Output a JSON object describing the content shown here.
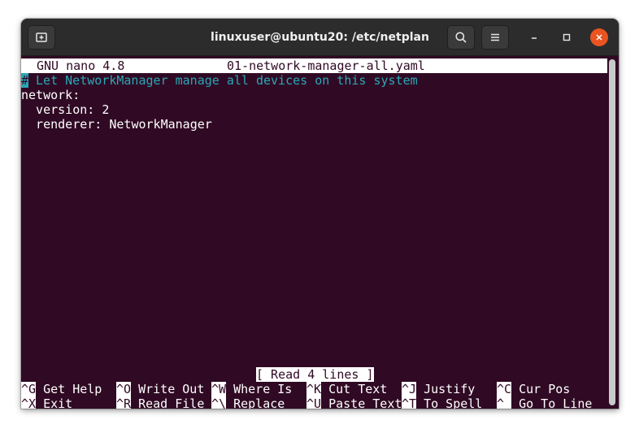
{
  "window": {
    "title": "linuxuser@ubuntu20: /etc/netplan",
    "new_tab_icon": "new-tab-icon",
    "search_icon": "search-icon",
    "menu_icon": "hamburger-menu-icon",
    "minimize_icon": "minimize-icon",
    "maximize_icon": "maximize-icon",
    "close_icon": "close-icon",
    "accent_color": "#e95420",
    "terminal_bg": "#300a24"
  },
  "nano": {
    "version": "GNU nano 4.8",
    "filename": "01-network-manager-all.yaml",
    "lines": [
      {
        "cursor": "#",
        "text": " Let NetworkManager manage all devices on this system",
        "type": "comment"
      },
      {
        "text": "network:",
        "type": "code"
      },
      {
        "text": "  version: 2",
        "type": "code"
      },
      {
        "text": "  renderer: NetworkManager",
        "type": "code"
      }
    ],
    "status": "[ Read 4 lines ]",
    "shortcuts_row1": [
      {
        "key": "^G",
        "label": " Get Help"
      },
      {
        "key": "^O",
        "label": " Write Out"
      },
      {
        "key": "^W",
        "label": " Where Is"
      },
      {
        "key": "^K",
        "label": " Cut Text"
      },
      {
        "key": "^J",
        "label": " Justify"
      },
      {
        "key": "^C",
        "label": " Cur Pos"
      }
    ],
    "shortcuts_row2": [
      {
        "key": "^X",
        "label": " Exit"
      },
      {
        "key": "^R",
        "label": " Read File"
      },
      {
        "key": "^\\",
        "label": " Replace"
      },
      {
        "key": "^U",
        "label": " Paste Text"
      },
      {
        "key": "^T",
        "label": " To Spell"
      },
      {
        "key": "^_",
        "label": " Go To Line"
      }
    ]
  }
}
